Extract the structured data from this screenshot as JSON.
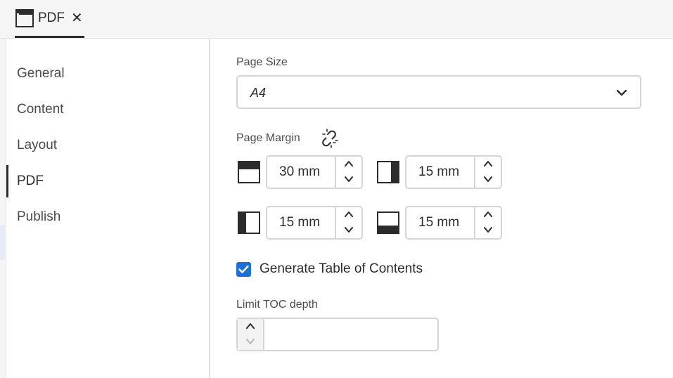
{
  "tab": {
    "label": "PDF",
    "close": "✕"
  },
  "sidebar": {
    "items": [
      {
        "label": "General"
      },
      {
        "label": "Content"
      },
      {
        "label": "Layout"
      },
      {
        "label": "PDF",
        "active": true
      },
      {
        "label": "Publish"
      }
    ]
  },
  "page_size": {
    "label": "Page Size",
    "value": "A4"
  },
  "page_margin": {
    "label": "Page Margin",
    "top": "30 mm",
    "right": "15 mm",
    "left": "15 mm",
    "bottom": "15 mm"
  },
  "toc": {
    "generate_label": "Generate Table of Contents",
    "checked": true
  },
  "toc_depth": {
    "label": "Limit TOC depth",
    "value": ""
  },
  "colors": {
    "accent": "#1f6fd6",
    "border": "#d5d5d5",
    "text": "#2c2c2c"
  }
}
